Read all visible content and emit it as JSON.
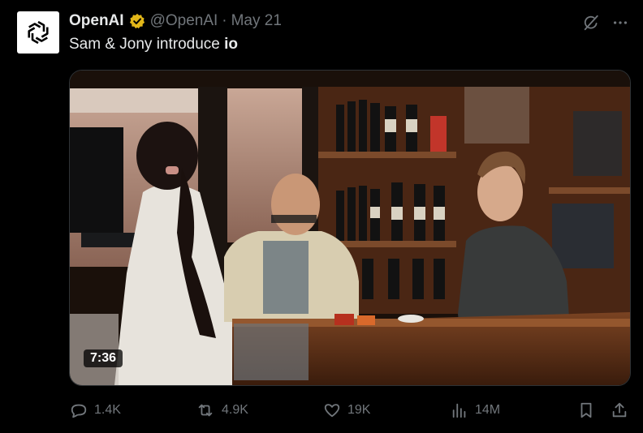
{
  "tweet": {
    "author_name": "OpenAI",
    "handle": "@OpenAI",
    "separator": "·",
    "date": "May 21",
    "text_prefix": "Sam & Jony introduce ",
    "text_bold": "io",
    "avatar_icon": "openai-logo-icon",
    "verified_icon": "verified-badge-icon",
    "accent_color": "#e2b719"
  },
  "media": {
    "type": "video",
    "duration": "7:36"
  },
  "actions": {
    "replies": "1.4K",
    "reposts": "4.9K",
    "likes": "19K",
    "views": "14M"
  },
  "icons": {
    "grok": "grok-icon",
    "more": "more-icon",
    "reply": "reply-icon",
    "repost": "repost-icon",
    "like": "like-icon",
    "views": "views-icon",
    "bookmark": "bookmark-icon",
    "share": "share-icon"
  }
}
